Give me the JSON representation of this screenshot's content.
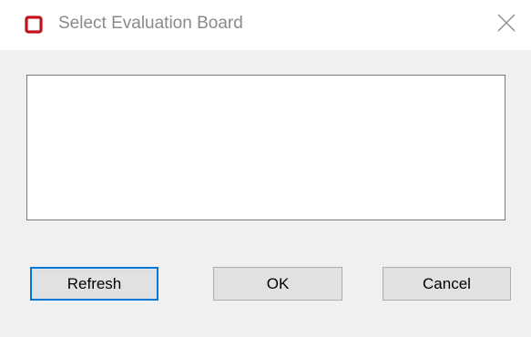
{
  "window": {
    "title": "Select Evaluation Board",
    "icon": "square-outline-icon",
    "icon_color": "#c0141c",
    "close_icon": "close-icon"
  },
  "board_list": {
    "items": []
  },
  "buttons": {
    "refresh_label": "Refresh",
    "ok_label": "OK",
    "cancel_label": "Cancel"
  },
  "colors": {
    "focus_border": "#0078d7",
    "button_face": "#e1e1e1",
    "dialog_background": "#f0f0f0"
  }
}
